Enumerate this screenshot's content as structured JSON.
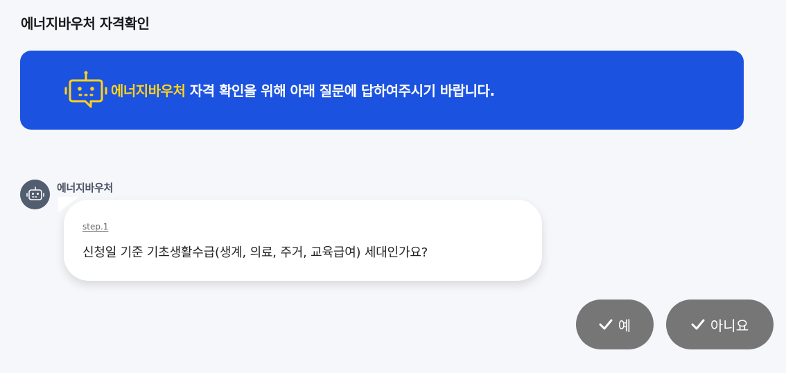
{
  "page": {
    "title": "에너지바우처 자격확인"
  },
  "banner": {
    "highlight": "에너지바우처",
    "text": " 자격 확인을 위해 아래 질문에 답하여주시기 바랍니다.",
    "icon": "robot-icon",
    "background_color": "#1b52e0",
    "highlight_color": "#ffd21a"
  },
  "chat": {
    "bot_name": "에너지바우처",
    "bot_avatar_icon": "robot-icon",
    "step_label": "step.1",
    "question": "신청일 기준 기초생활수급(생계, 의료, 주거, 교육급여) 세대인가요?"
  },
  "answers": {
    "yes_label": "예",
    "no_label": "아니요",
    "icon": "check-icon"
  }
}
